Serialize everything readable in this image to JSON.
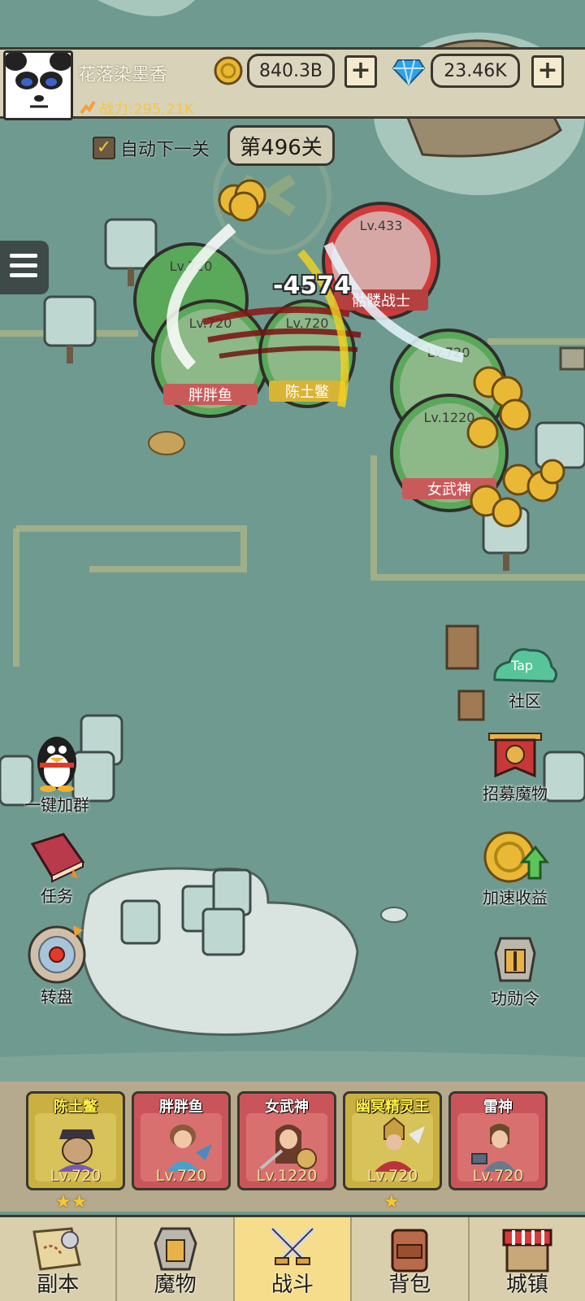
{
  "player": {
    "name": "花落染墨香",
    "power": "战力:295.21K"
  },
  "currency": {
    "gold": "840.3B",
    "gems": "23.46K"
  },
  "battle": {
    "auto_next_label": "自动下一关",
    "auto_next_checked": true,
    "stage": "第496关",
    "damage_text": "-4574",
    "units": [
      {
        "level": "Lv.720",
        "name": "",
        "side": "ally"
      },
      {
        "level": "Lv.720",
        "name": "胖胖鱼",
        "side": "ally"
      },
      {
        "level": "Lv.720",
        "name": "陈土鳖",
        "side": "ally"
      },
      {
        "level": "Lv.433",
        "name": "骷髅战士",
        "side": "enemy"
      },
      {
        "level": "Lv.720",
        "name": "",
        "side": "ally"
      },
      {
        "level": "Lv.1220",
        "name": "女武神",
        "side": "ally"
      }
    ]
  },
  "side_buttons": {
    "community": "社区",
    "community_tag": "Tap",
    "recruit": "招募魔物",
    "speed_income": "加速收益",
    "merit": "功勋令",
    "join_group": "一键加群",
    "tasks": "任务",
    "wheel": "转盘"
  },
  "heroes": [
    {
      "name": "陈土鳖",
      "level": "Lv.720",
      "stars": "★★",
      "rarity": "gold"
    },
    {
      "name": "胖胖鱼",
      "level": "Lv.720",
      "stars": "",
      "rarity": "red"
    },
    {
      "name": "女武神",
      "level": "Lv.1220",
      "stars": "",
      "rarity": "red"
    },
    {
      "name": "幽冥精灵王",
      "level": "Lv.720",
      "stars": "★",
      "rarity": "gold"
    },
    {
      "name": "雷神",
      "level": "Lv.720",
      "stars": "",
      "rarity": "red"
    }
  ],
  "nav": {
    "dungeon": "副本",
    "monsters": "魔物",
    "battle": "战斗",
    "bag": "背包",
    "town": "城镇",
    "active": "battle"
  },
  "colors": {
    "ally_ring": "#5aa85a",
    "enemy_ring": "#d23a3a",
    "gold_card": "#c9b040",
    "red_card": "#c9555a",
    "active_tab": "#f6dd8b"
  }
}
